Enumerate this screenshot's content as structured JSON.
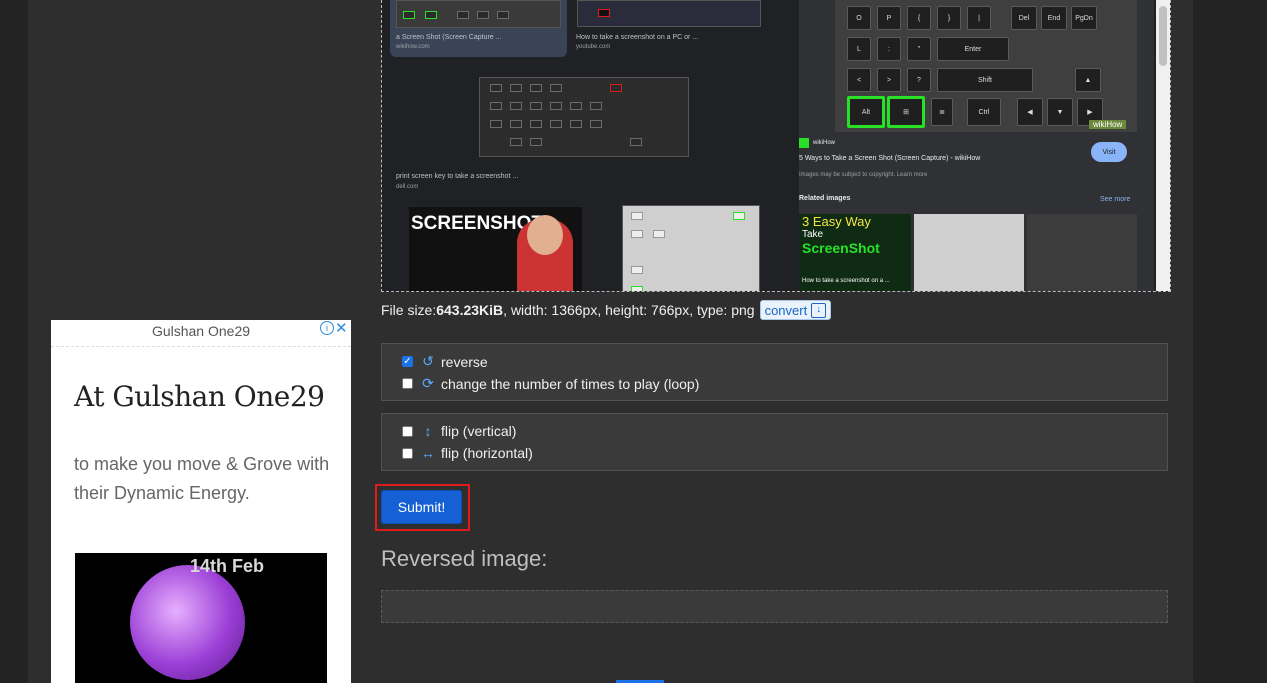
{
  "preview": {
    "results": [
      {
        "caption": "a Screen Shot (Screen Capture ...",
        "source": "wikihow.com"
      },
      {
        "caption": "How to take a screenshot on a PC or ...",
        "source": "youtube.com"
      },
      {
        "caption": "print screen key to take a screenshot ...",
        "source": "dell.com"
      }
    ],
    "thumb_text": "SCREENSHOT",
    "side": {
      "brand": "wikiHow",
      "title": "5 Ways to Take a Screen Shot (Screen Capture) - wikiHow",
      "note": "Images may be subject to copyright. Learn more",
      "visit": "Visit",
      "related": "Related images",
      "see_more": "See more",
      "related_caption": "How to take a screenshot on a ...",
      "related_overlay_1": "3 Easy Way",
      "related_overlay_2": "Take",
      "related_overlay_3": "ScreenShot",
      "watermark": "wikiHow",
      "keys": [
        "O",
        "P",
        "{",
        "}",
        "|",
        "Del",
        "End",
        "PgDn",
        "L",
        ":",
        "\"",
        "Enter",
        "<",
        ">",
        "?",
        "Shift",
        "Alt",
        "Ctrl"
      ]
    }
  },
  "file_info": {
    "size_label": "File size: ",
    "size_value": "643.23KiB",
    "dims": ", width: 1366px, height: 766px, type: png",
    "convert_label": "convert"
  },
  "options": {
    "reverse_label": "reverse",
    "reverse_checked": true,
    "loop_label": "change the number of times to play (loop)",
    "flip_v_label": "flip (vertical)",
    "flip_h_label": "flip (horizontal)"
  },
  "submit_label": "Submit!",
  "result_heading": "Reversed image:",
  "ad": {
    "brand": "Gulshan One29",
    "headline": "At Gulshan One29",
    "body": "to make you move & Grove with their Dynamic Energy.",
    "date_text": "14th Feb"
  },
  "colors": {
    "accent": "#1560d4",
    "highlight": "#e01b1b",
    "key_highlight": "#27e027"
  }
}
